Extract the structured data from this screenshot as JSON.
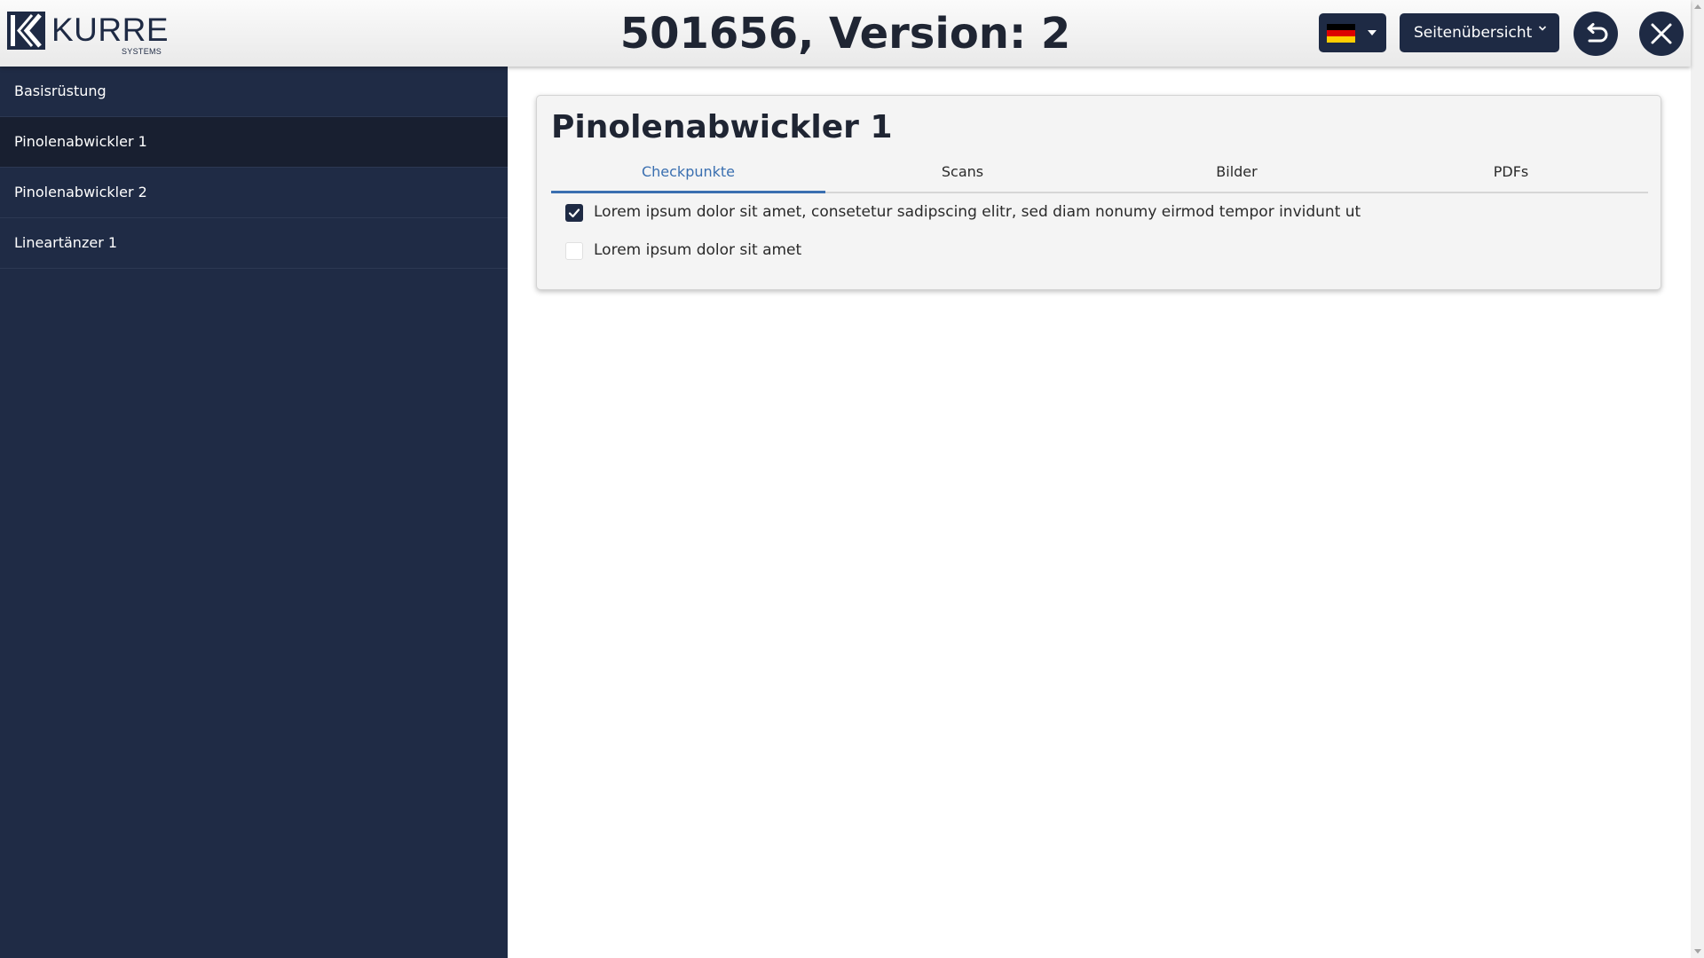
{
  "header": {
    "logo_text": "KURRE",
    "logo_sub": "SYSTEMS",
    "title": "501656, Version: 2",
    "language_flag": "flag-germany-icon",
    "overview_label": "Seitenübersicht",
    "back_icon": "undo-arrow-icon",
    "close_icon": "close-icon"
  },
  "sidebar": {
    "items": [
      {
        "label": "Basisrüstung",
        "active": false
      },
      {
        "label": "Pinolenabwickler 1",
        "active": true
      },
      {
        "label": "Pinolenabwickler 2",
        "active": false
      },
      {
        "label": "Lineartänzer 1",
        "active": false
      }
    ]
  },
  "main": {
    "card_title": "Pinolenabwickler 1",
    "tabs": [
      {
        "label": "Checkpunkte",
        "active": true
      },
      {
        "label": "Scans",
        "active": false
      },
      {
        "label": "Bilder",
        "active": false
      },
      {
        "label": "PDFs",
        "active": false
      }
    ],
    "checkpoints": [
      {
        "label": "Lorem ipsum dolor sit amet, consetetur sadipscing elitr, sed diam nonumy eirmod tempor invidunt ut",
        "checked": true
      },
      {
        "label": "Lorem ipsum dolor sit amet",
        "checked": false
      }
    ]
  },
  "colors": {
    "primary": "#1e2a44",
    "sidebar_bg": "#1f2b45",
    "sidebar_active": "#181f30",
    "tab_active": "#3a6fb0"
  }
}
